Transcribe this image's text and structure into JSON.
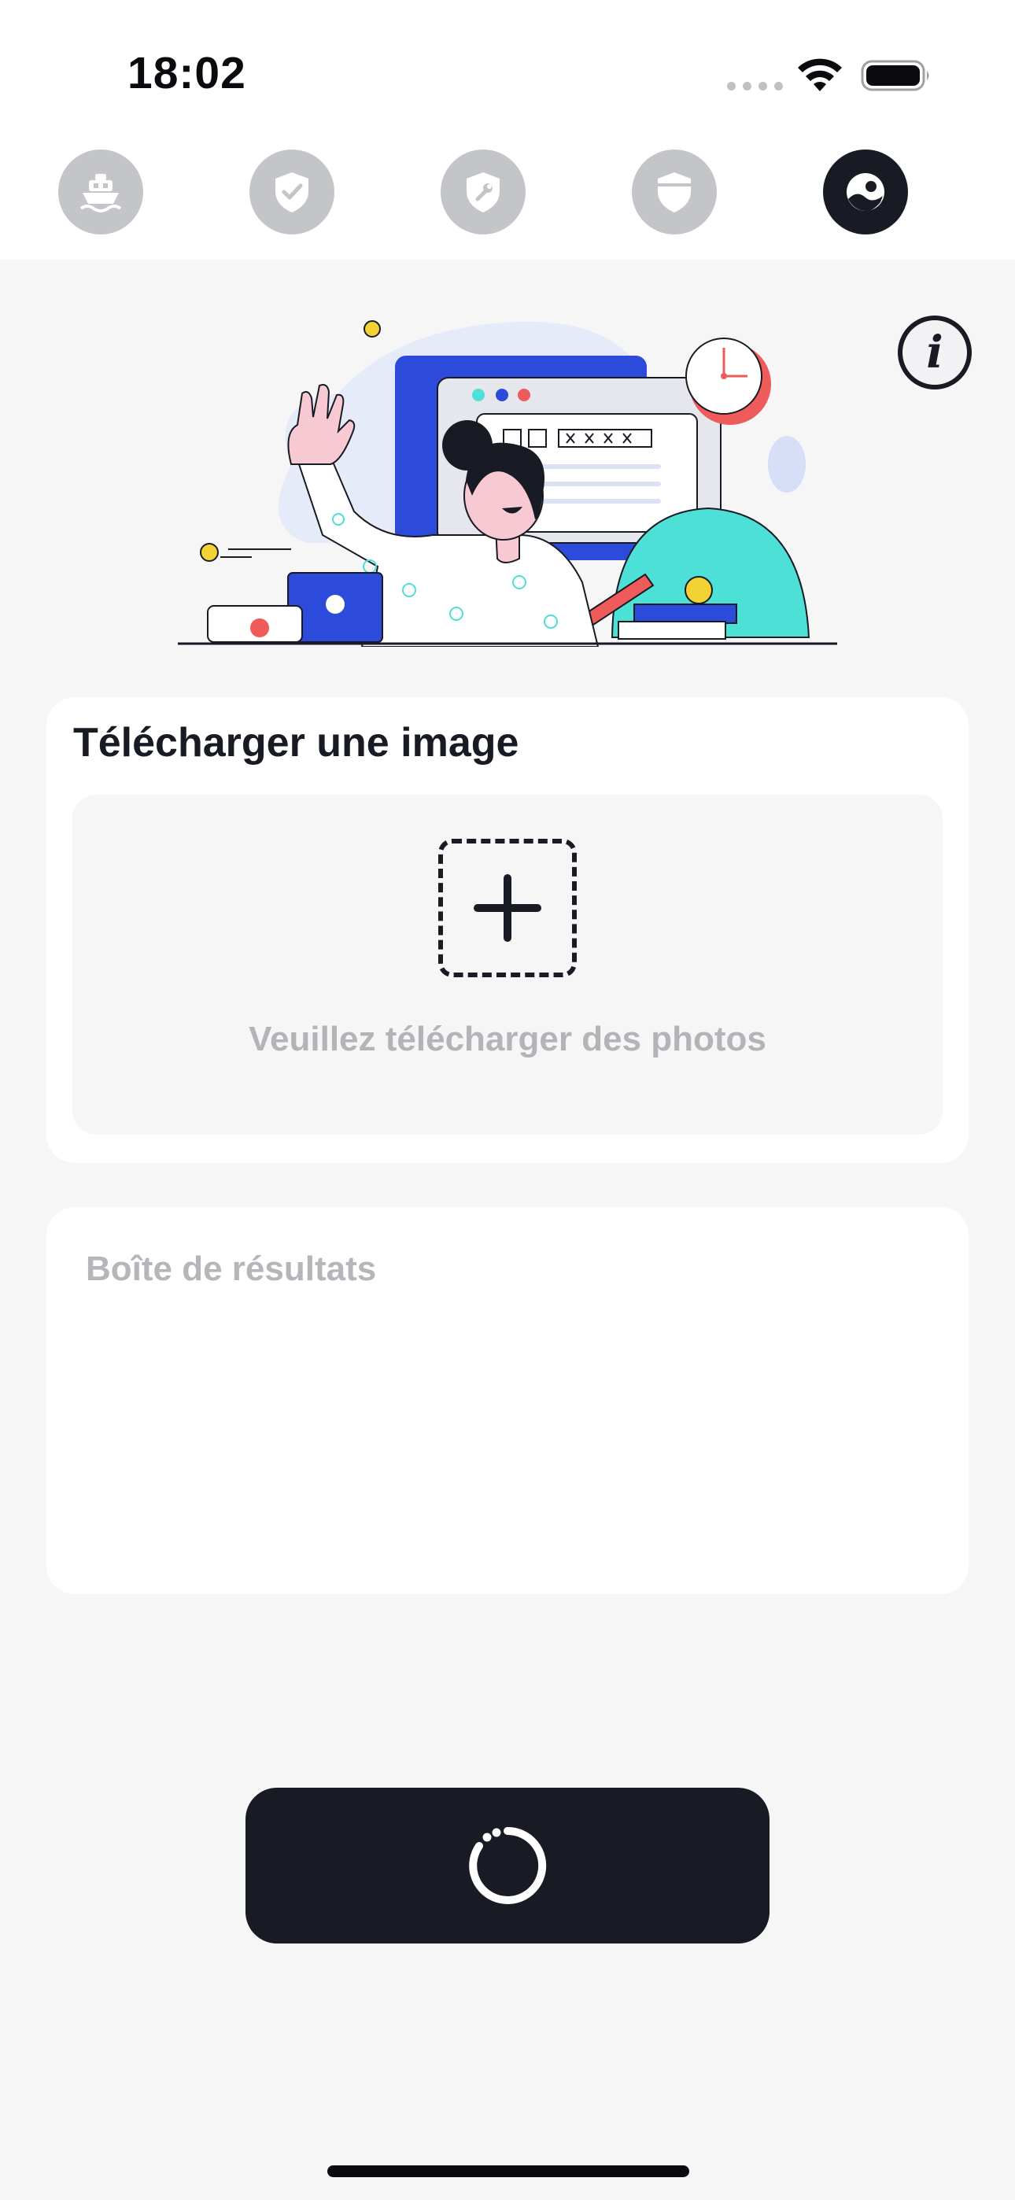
{
  "status_bar": {
    "time": "18:02"
  },
  "tabs": [
    {
      "icon": "ship-icon",
      "active": false
    },
    {
      "icon": "shield-check-icon",
      "active": false
    },
    {
      "icon": "shield-wrench-icon",
      "active": false
    },
    {
      "icon": "shield-icon",
      "active": false
    },
    {
      "icon": "face-image-icon",
      "active": true
    }
  ],
  "upload": {
    "title": "Télécharger une image",
    "hint": "Veuillez télécharger des photos"
  },
  "result": {
    "placeholder": "Boîte de résultats"
  },
  "submit": {
    "state": "loading",
    "icon": "spinner-icon"
  },
  "colors": {
    "primary_dark": "#181B24",
    "tab_inactive": "#C4C5C9",
    "background": "#F6F6F7",
    "muted_text": "#B3B4B8"
  }
}
